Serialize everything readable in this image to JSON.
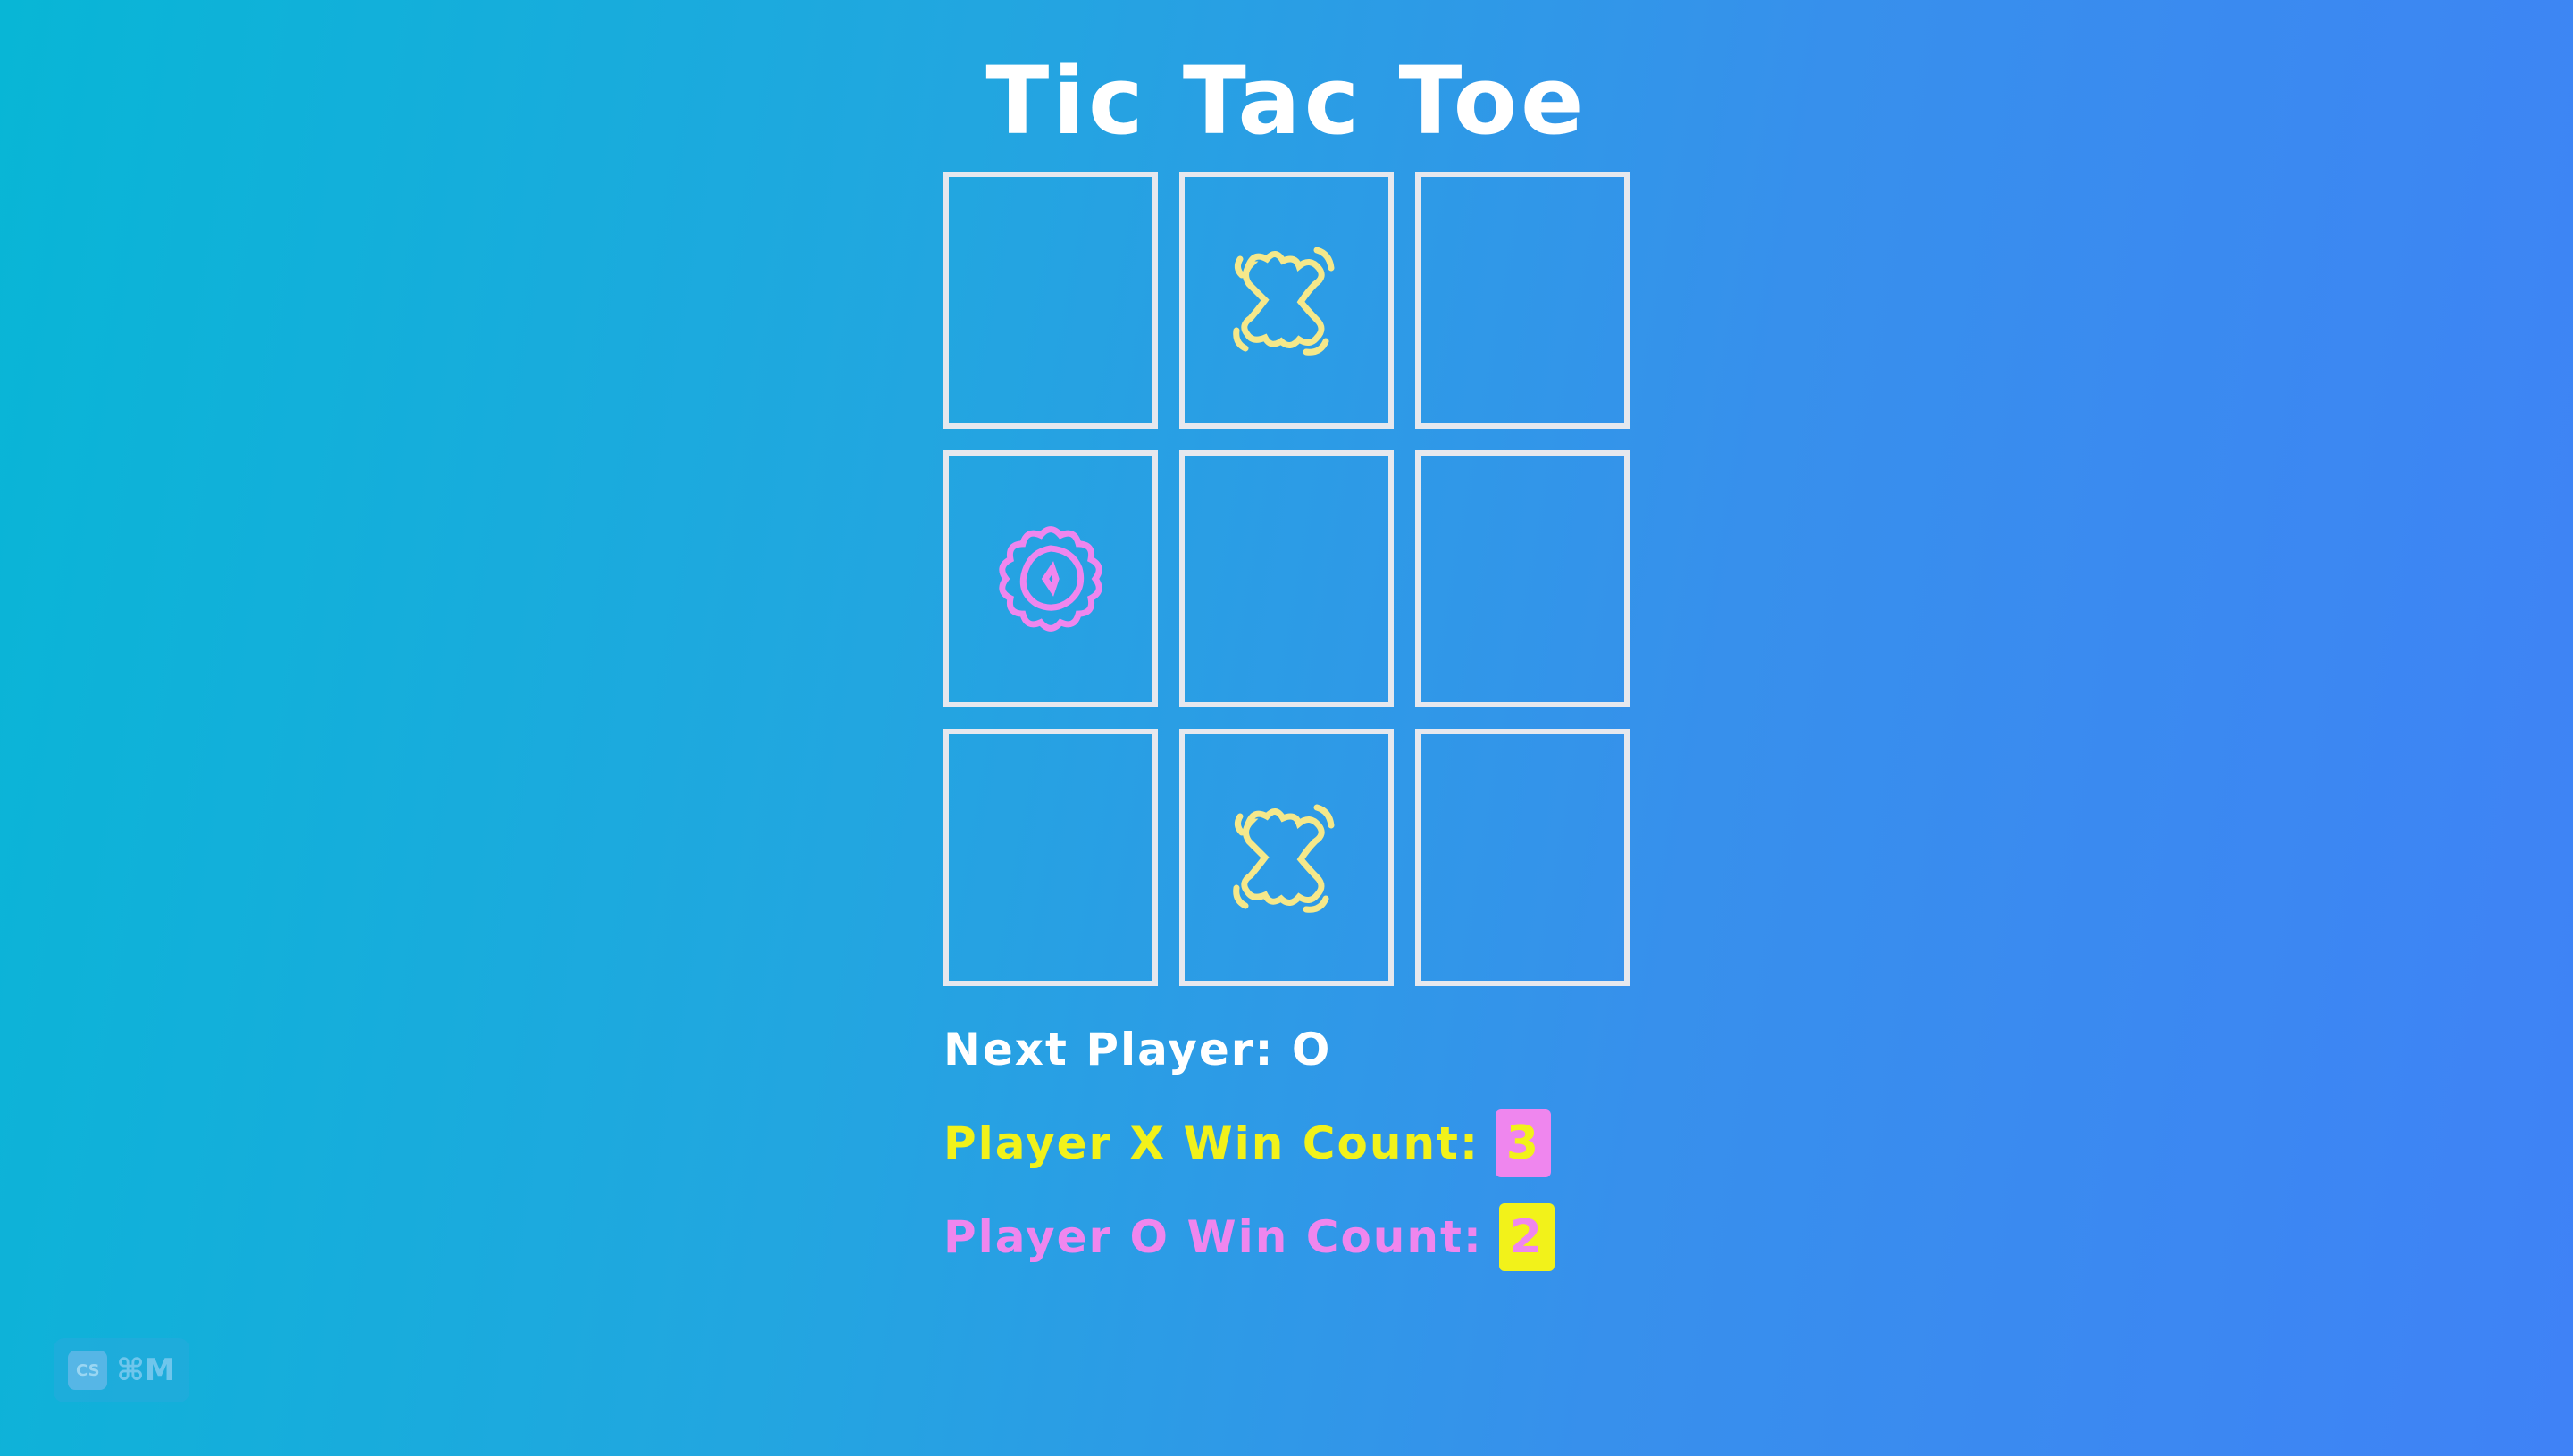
{
  "title": "Tic Tac Toe",
  "board": {
    "cells": [
      "",
      "X",
      "",
      "O",
      "",
      "",
      "",
      "X",
      ""
    ]
  },
  "status": {
    "next_player_label": "Next Player: O",
    "x_win_label": "Player X Win Count:",
    "x_win_count": "3",
    "o_win_label": "Player O Win Count:",
    "o_win_count": "2"
  },
  "shortcut": {
    "logo_text": "CS",
    "keys": "⌘M"
  },
  "colors": {
    "x_mark": "#f5e88a",
    "o_mark": "#ef86ee",
    "x_text": "#f2f21a",
    "o_text": "#ef86ee",
    "cell_border": "#e6e8ee"
  }
}
